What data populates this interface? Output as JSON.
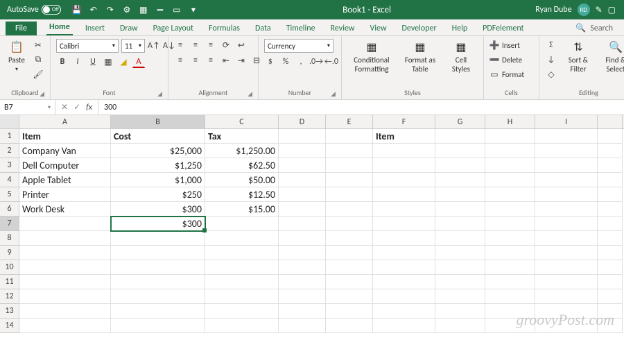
{
  "titlebar": {
    "autosave": "AutoSave",
    "toggle": "Off",
    "title": "Book1 - Excel",
    "user": "Ryan Dube",
    "avatar": "RD"
  },
  "tabs": {
    "file": "File",
    "home": "Home",
    "insert": "Insert",
    "draw": "Draw",
    "pagelayout": "Page Layout",
    "formulas": "Formulas",
    "data": "Data",
    "timeline": "Timeline",
    "review": "Review",
    "view": "View",
    "developer": "Developer",
    "help": "Help",
    "pdf": "PDFelement",
    "search": "Search"
  },
  "ribbon": {
    "clipboard": {
      "paste": "Paste",
      "label": "Clipboard"
    },
    "font": {
      "name": "Calibri",
      "size": "11",
      "label": "Font"
    },
    "alignment": {
      "label": "Alignment"
    },
    "number": {
      "format": "Currency",
      "label": "Number"
    },
    "styles": {
      "cond": "Conditional Formatting",
      "table": "Format as Table",
      "cell": "Cell Styles",
      "label": "Styles"
    },
    "cells": {
      "insert": "Insert",
      "delete": "Delete",
      "format": "Format",
      "label": "Cells"
    },
    "editing": {
      "sort": "Sort & Filter",
      "find": "Find & Select",
      "label": "Editing"
    }
  },
  "formulabar": {
    "name": "B7",
    "value": "300"
  },
  "columns": [
    "A",
    "B",
    "C",
    "D",
    "E",
    "F",
    "G",
    "H",
    "I",
    ""
  ],
  "sheet": {
    "headers": {
      "a": "Item",
      "b": "Cost",
      "c": "Tax",
      "f": "Item"
    },
    "rows": [
      {
        "a": "Company Van",
        "b": "$25,000",
        "c": "$1,250.00"
      },
      {
        "a": "Dell Computer",
        "b": "$1,250",
        "c": "$62.50"
      },
      {
        "a": "Apple Tablet",
        "b": "$1,000",
        "c": "$50.00"
      },
      {
        "a": "Printer",
        "b": "$250",
        "c": "$12.50"
      },
      {
        "a": "Work Desk",
        "b": "$300",
        "c": "$15.00"
      }
    ],
    "b7": "$300"
  },
  "watermark": "groovyPost.com"
}
